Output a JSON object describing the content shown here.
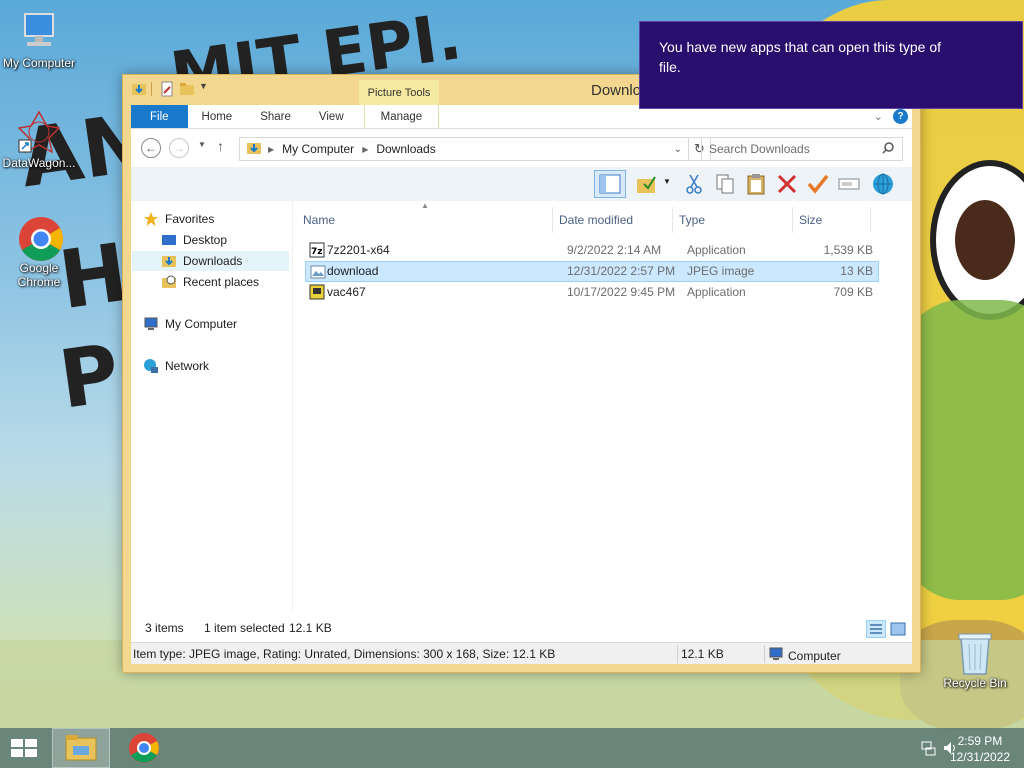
{
  "desktop": {
    "icons": [
      {
        "label": "My Computer"
      },
      {
        "label": "DataWagon..."
      },
      {
        "label": "Google Chrome"
      },
      {
        "label": "Recycle Bin"
      }
    ]
  },
  "window": {
    "title": "Downlo",
    "contextual_tab": "Picture Tools",
    "ribbon_tabs": [
      "File",
      "Home",
      "Share",
      "View",
      "Manage"
    ]
  },
  "address": {
    "crumbs": [
      "My Computer",
      "Downloads"
    ],
    "search_placeholder": "Search Downloads"
  },
  "navpane": {
    "items": [
      {
        "label": "Favorites",
        "icon": "star-icon"
      },
      {
        "label": "Desktop",
        "icon": "desktop-icon"
      },
      {
        "label": "Downloads",
        "icon": "downloads-folder-icon",
        "selected": true
      },
      {
        "label": "Recent places",
        "icon": "recent-places-icon"
      },
      {
        "label": "My Computer",
        "icon": "computer-icon"
      },
      {
        "label": "Network",
        "icon": "network-icon"
      }
    ]
  },
  "files": {
    "columns": [
      "Name",
      "Date modified",
      "Type",
      "Size"
    ],
    "rows": [
      {
        "name": "7z2201-x64",
        "date": "9/2/2022 2:14 AM",
        "type": "Application",
        "size": "1,539 KB",
        "icon": "7zip-app-icon"
      },
      {
        "name": "download",
        "date": "12/31/2022 2:57 PM",
        "type": "JPEG image",
        "size": "13 KB",
        "icon": "image-file-icon",
        "selected": true
      },
      {
        "name": "vac467",
        "date": "10/17/2022 9:45 PM",
        "type": "Application",
        "size": "709 KB",
        "icon": "installer-app-icon"
      }
    ]
  },
  "status": {
    "items_count": "3 items",
    "selection": "1 item selected",
    "selection_size": "12.1 KB"
  },
  "details": {
    "info": "Item type: JPEG image, Rating: Unrated, Dimensions: 300 x 168, Size: 12.1 KB",
    "size": "12.1 KB",
    "location": "Computer"
  },
  "toast": {
    "message": "You have new apps that can open this type of file."
  },
  "taskbar": {
    "time": "2:59 PM",
    "date": "12/31/2022"
  },
  "colors": {
    "accent": "#1979ca",
    "window_frame": "#f3d78e",
    "selection": "#cce8ff",
    "toast_bg": "#2a0e6e"
  }
}
